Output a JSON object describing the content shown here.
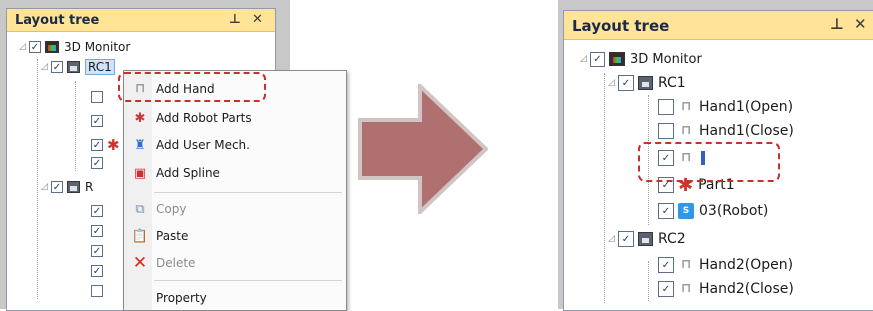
{
  "left_panel": {
    "title": "Layout tree",
    "pin_glyph": "⊥",
    "close_glyph": "✕",
    "nodes": [
      {
        "label": "3D Monitor",
        "checked": true,
        "icon": "monitor-icon"
      },
      {
        "label": "RC1",
        "checked": true,
        "icon": "controller-icon"
      },
      {
        "label": "",
        "checked": false,
        "icon": "hand-icon"
      },
      {
        "label": "",
        "checked": true,
        "icon": "hand-icon"
      },
      {
        "label": "",
        "checked": true,
        "icon": "parts-icon"
      },
      {
        "label": "",
        "checked": true,
        "icon": "robot-icon"
      },
      {
        "label": "R",
        "checked": true,
        "icon": "controller-icon"
      }
    ]
  },
  "context_menu": {
    "items": [
      {
        "label": "Add Hand",
        "icon": "hand-icon",
        "enabled": true
      },
      {
        "label": "Add Robot Parts",
        "icon": "parts-icon",
        "enabled": true
      },
      {
        "label": "Add User Mech.",
        "icon": "user-mech-icon",
        "enabled": true
      },
      {
        "label": "Add Spline",
        "icon": "spline-icon",
        "enabled": true
      },
      {
        "label": "Copy",
        "icon": "copy-icon",
        "enabled": false
      },
      {
        "label": "Paste",
        "icon": "paste-icon",
        "enabled": true
      },
      {
        "label": "Delete",
        "icon": "delete-icon",
        "enabled": false
      },
      {
        "label": "Property",
        "icon": "",
        "enabled": true
      }
    ]
  },
  "right_panel": {
    "title": "Layout tree",
    "pin_glyph": "⊥",
    "close_glyph": "✕",
    "nodes": [
      {
        "label": "3D Monitor",
        "checked": true,
        "icon": "monitor-icon"
      },
      {
        "label": "RC1",
        "checked": true,
        "icon": "controller-icon"
      },
      {
        "label": "Hand1(Open)",
        "checked": false,
        "icon": "hand-icon"
      },
      {
        "label": "Hand1(Close)",
        "checked": false,
        "icon": "hand-icon"
      },
      {
        "label": "",
        "checked": true,
        "icon": "hand-icon"
      },
      {
        "label": "Part1",
        "checked": true,
        "icon": "parts-icon"
      },
      {
        "label": "03(Robot)",
        "checked": true,
        "icon": "robot-icon"
      },
      {
        "label": "RC2",
        "checked": true,
        "icon": "controller-icon"
      },
      {
        "label": "Hand2(Open)",
        "checked": true,
        "icon": "hand-icon"
      },
      {
        "label": "Hand2(Close)",
        "checked": true,
        "icon": "hand-icon"
      }
    ]
  },
  "colors": {
    "header_bg": "#ffe497",
    "highlight_dash": "#c9302c",
    "arrow_fill": "#b07070",
    "arrow_border": "#d0c4c4"
  }
}
